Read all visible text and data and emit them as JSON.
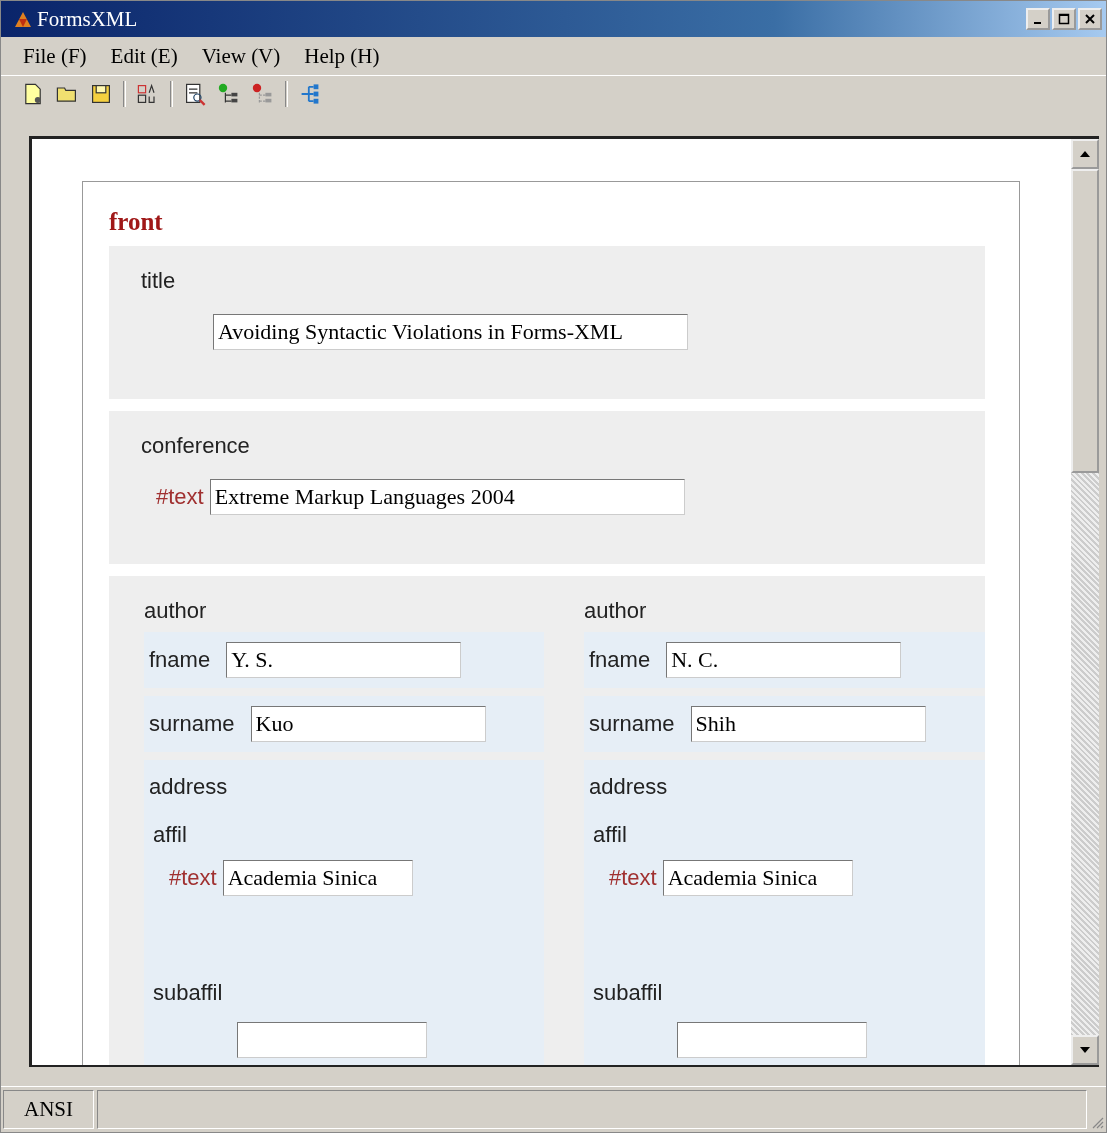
{
  "window": {
    "title": "FormsXML"
  },
  "menu": [
    "File (F)",
    "Edit (E)",
    "View (V)",
    "Help (H)"
  ],
  "status_bar": {
    "encoding": "ANSI"
  },
  "front": {
    "name": "front",
    "title": {
      "label": "title",
      "value": "Avoiding Syntactic Violations in Forms-XML"
    },
    "conference": {
      "label": "conference",
      "text_label": "#text",
      "value": "Extreme Markup Languages 2004"
    },
    "authors": [
      {
        "label": "author",
        "fname": {
          "label": "fname",
          "value": "Y. S."
        },
        "surname": {
          "label": "surname",
          "value": "Kuo"
        },
        "address": {
          "label": "address",
          "affil": {
            "label": "affil",
            "text_label": "#text",
            "value": "Academia Sinica"
          },
          "subaffil": {
            "label": "subaffil"
          }
        }
      },
      {
        "label": "author",
        "fname": {
          "label": "fname",
          "value": "N. C."
        },
        "surname": {
          "label": "surname",
          "value": "Shih"
        },
        "address": {
          "label": "address",
          "affil": {
            "label": "affil",
            "text_label": "#text",
            "value": "Academia Sinica"
          },
          "subaffil": {
            "label": "subaffil"
          }
        }
      }
    ]
  }
}
